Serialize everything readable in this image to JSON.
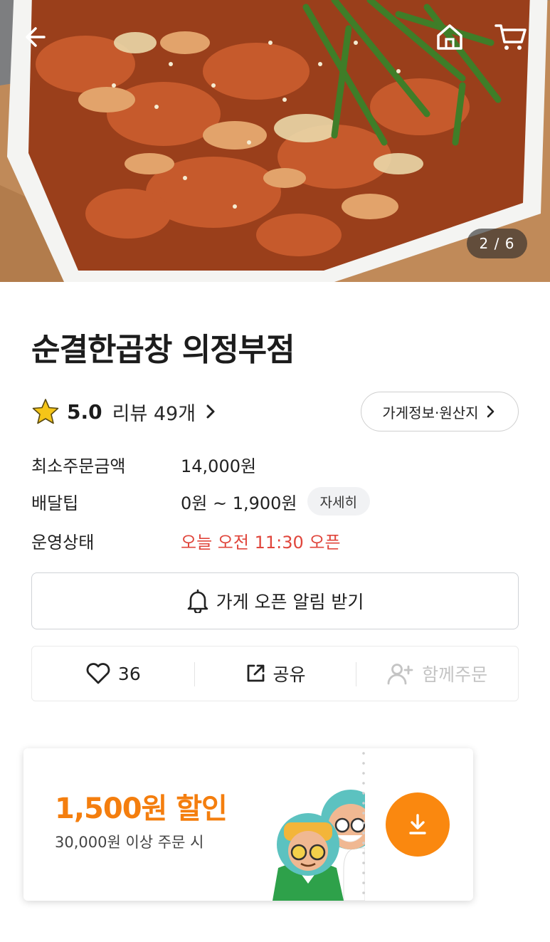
{
  "hero": {
    "counter": "2 / 6",
    "colors": {
      "overlay_icon": "#ffffff",
      "counter_bg": "#282828"
    }
  },
  "store": {
    "name": "순결한곱창 의정부점",
    "rating": "5.0",
    "reviews_label": "리뷰 49개",
    "info_button": "가게정보·원산지",
    "info": [
      {
        "label": "최소주문금액",
        "value": "14,000원"
      },
      {
        "label": "배달팁",
        "value": "0원 ~ 1,900원",
        "chip": "자세히"
      },
      {
        "label": "운영상태",
        "value": "오늘 오전 11:30 오픈"
      }
    ],
    "alarm_button": "가게 오픈 알림 받기"
  },
  "actions": {
    "like_count": "36",
    "share_label": "공유",
    "group_order_label": "함께주문"
  },
  "coupon": {
    "title": "1,500원 할인",
    "condition": "30,000원 이상 주문 시",
    "accent": "#f47e0e",
    "button_color": "#fa880f"
  },
  "colors": {
    "status_red": "#e0463c",
    "star": "#f5c518"
  }
}
